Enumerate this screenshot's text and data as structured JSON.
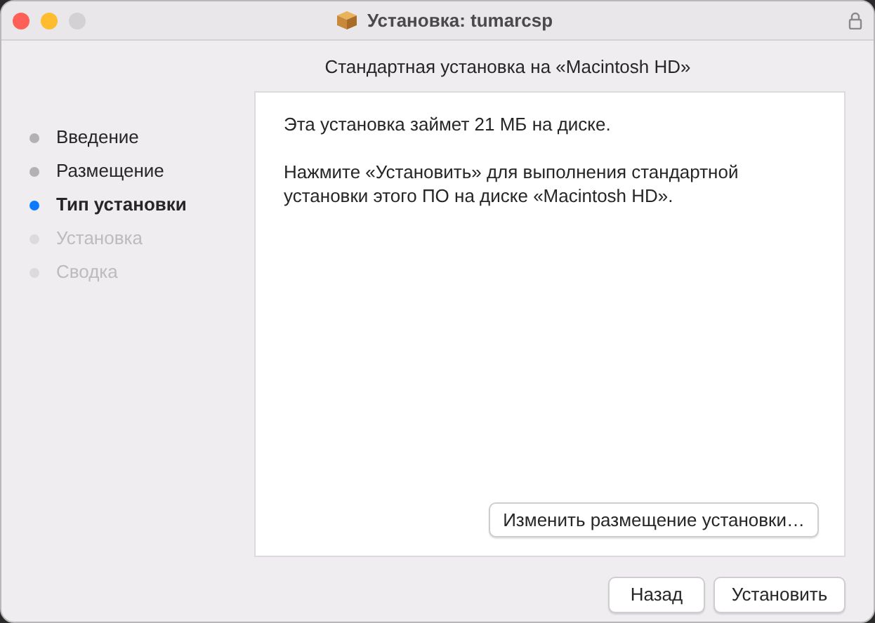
{
  "window": {
    "title": "Установка: tumarcsp"
  },
  "steps": [
    {
      "label": "Введение",
      "selected": false,
      "disabled": false
    },
    {
      "label": "Размещение",
      "selected": false,
      "disabled": false
    },
    {
      "label": "Тип установки",
      "selected": true,
      "disabled": false
    },
    {
      "label": "Установка",
      "selected": false,
      "disabled": true
    },
    {
      "label": "Сводка",
      "selected": false,
      "disabled": true
    }
  ],
  "heading": "Стандартная установка на «Macintosh HD»",
  "panel": {
    "paragraphs": [
      "Эта установка займет 21 МБ на диске.",
      "Нажмите «Установить» для выполнения стандартной установки этого ПО на диске «Macintosh HD»."
    ],
    "change_button": "Изменить размещение установки…"
  },
  "buttons": [
    "Назад",
    "Установить"
  ]
}
